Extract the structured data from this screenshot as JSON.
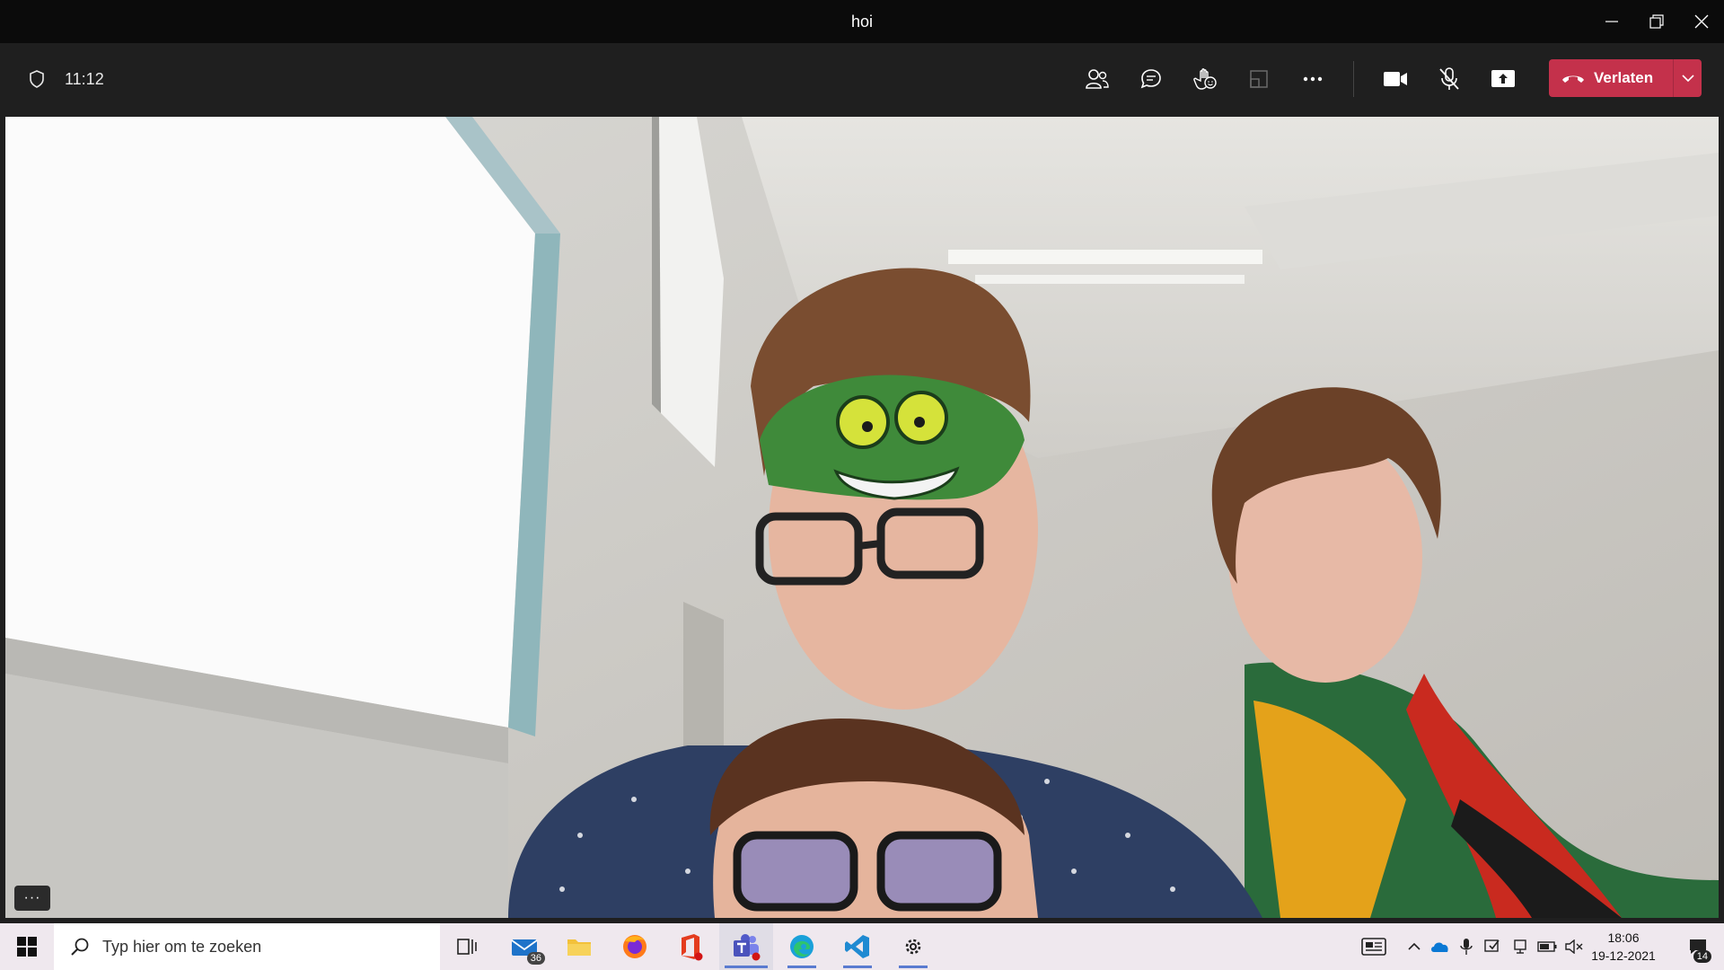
{
  "window": {
    "title": "hoi"
  },
  "meeting": {
    "timer": "11:12",
    "leave_label": "Verlaten",
    "controls": [
      "people-icon",
      "chat-icon",
      "reactions-icon",
      "room-icon",
      "more-icon",
      "camera-icon",
      "mic-muted-icon",
      "share-icon"
    ]
  },
  "video": {
    "more_label": "···"
  },
  "taskbar": {
    "search_placeholder": "Typ hier om te zoeken",
    "mail_badge": "36",
    "clock_time": "18:06",
    "clock_date": "19-12-2021",
    "notification_count": "14"
  },
  "colors": {
    "accent_leave": "#c4314b",
    "taskbar_bg": "#efe8ee",
    "meeting_bg": "#1f1f1f"
  }
}
